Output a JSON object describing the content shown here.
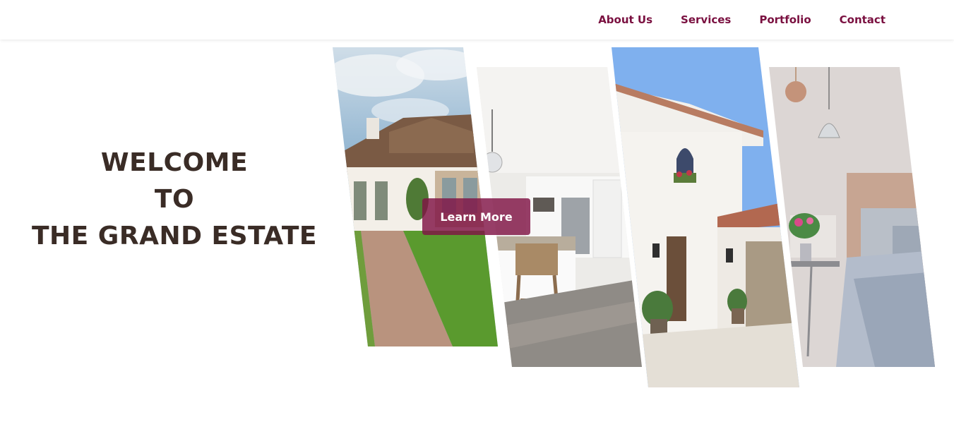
{
  "nav": {
    "items": [
      {
        "label": "About Us"
      },
      {
        "label": "Services"
      },
      {
        "label": "Portfolio"
      },
      {
        "label": "Contact"
      }
    ]
  },
  "hero": {
    "welcome_line1": "WELCOME",
    "welcome_line2": "TO",
    "welcome_line3": "THE GRAND ESTATE",
    "button_label": "Learn More"
  },
  "colors": {
    "nav_text": "#7a1040",
    "heading_text": "#3a2c26",
    "button_bg": "#801446"
  },
  "gallery": {
    "images": [
      {
        "name": "house-exterior-image"
      },
      {
        "name": "kitchen-interior-image"
      },
      {
        "name": "white-villa-image"
      },
      {
        "name": "bedroom-interior-image"
      }
    ]
  }
}
